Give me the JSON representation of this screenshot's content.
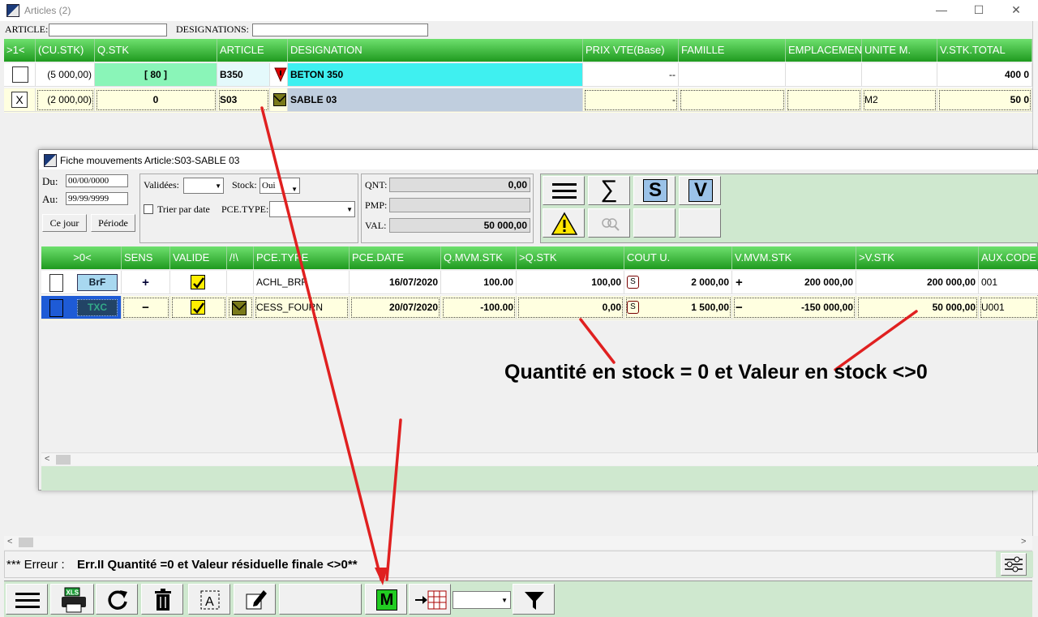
{
  "main_window": {
    "title": "Articles (2)",
    "controls": [
      "—",
      "☐",
      "✕"
    ],
    "filters": {
      "article_label": "ARTICLE:",
      "article_value": "",
      "designations_label": "DESIGNATIONS:",
      "designations_value": ""
    },
    "columns": [
      ">1<",
      "(CU.STK)",
      "Q.STK",
      "ARTICLE",
      "DESIGNATION",
      "PRIX VTE(Base)",
      "FAMILLE",
      "EMPLACEMEN",
      "UNITE M.",
      "V.STK.TOTAL"
    ],
    "rows": [
      {
        "cu_stk": "(5 000,00)",
        "q_stk": "[ 80 ]",
        "article": "B350",
        "designation": "BETON 350",
        "prix": "--",
        "famille": "",
        "emplacement": "",
        "unite": "",
        "vstk": "400 0"
      },
      {
        "select_mark": "X",
        "cu_stk": "(2 000,00)",
        "q_stk": "0",
        "article": "S03",
        "designation": "SABLE 03",
        "prix": "-",
        "famille": "",
        "emplacement": "",
        "unite": "M2",
        "vstk": "50 0"
      }
    ]
  },
  "fiche": {
    "title": "Fiche mouvements Article:S03-SABLE 03",
    "du_label": "Du:",
    "du_value": "00/00/0000",
    "au_label": "Au:",
    "au_value": "99/99/9999",
    "ce_jour": "Ce jour",
    "periode": "Période",
    "validees_label": "Validées:",
    "validees_value": "",
    "stock_label": "Stock:",
    "stock_value": "Oui",
    "trier_label": "Trier par date",
    "pce_type_label": "PCE.TYPE:",
    "pce_type_value": "",
    "qnt_label": "QNT:",
    "qnt_value": "0,00",
    "pmp_label": "PMP:",
    "pmp_value": "",
    "val_label": "VAL:",
    "val_value": "50 000,00",
    "toolbar": {
      "s_label": "S",
      "v_label": "V"
    },
    "columns": [
      ">0<",
      "SENS",
      "VALIDE",
      "/!\\",
      "PCE.TYPE",
      "PCE.DATE",
      "Q.MVM.STK",
      ">Q.STK",
      "COUT U.",
      "V.MVM.STK",
      ">V.STK",
      "AUX.CODE"
    ],
    "rows": [
      {
        "badge": "BrF",
        "sens": "+",
        "pce_type": "ACHL_BRF",
        "pce_date": "16/07/2020",
        "q_mvm": "100.00",
        "q_stk": "100,00",
        "cout_s": "S",
        "cout": "2 000,00",
        "v_sign": "+",
        "v_mvm": "200 000,00",
        "v_stk": "200 000,00",
        "aux": "001"
      },
      {
        "badge": "TXC",
        "sens": "−",
        "pce_type": "CESS_FOURN",
        "pce_date": "20/07/2020",
        "q_mvm": "-100.00",
        "q_stk": "0,00",
        "cout_s": "S",
        "cout": "1 500,00",
        "v_sign": "−",
        "v_mvm": "-150 000,00",
        "v_stk": "50 000,00",
        "aux": "U001"
      }
    ]
  },
  "annotation": "Quantité en stock = 0 et Valeur en stock <>0",
  "status": {
    "prefix": "*** Erreur :",
    "message": "Err.II Quantité =0 et Valeur résiduelle finale <>0**"
  },
  "bottom_toolbar": {
    "m_label": "M",
    "combo_value": ""
  },
  "colors": {
    "header_green": "#1f9a1f",
    "cyan": "#3ff0f0",
    "mint": "#8af5b8",
    "arrow_red": "#e02020",
    "cream": "#ffffe0"
  }
}
